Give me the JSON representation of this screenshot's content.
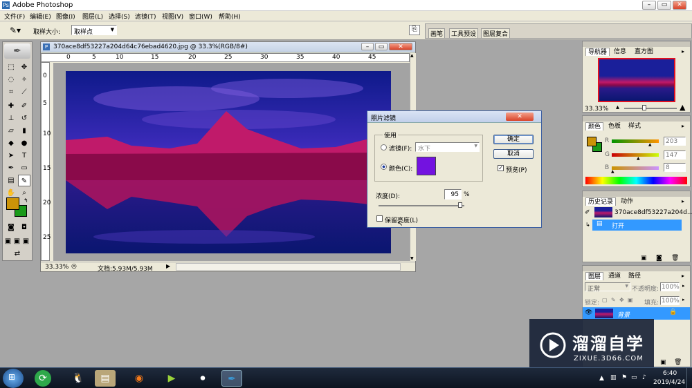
{
  "app": {
    "title": "Adobe Photoshop"
  },
  "menu": [
    "文件(F)",
    "编辑(E)",
    "图像(I)",
    "图层(L)",
    "选择(S)",
    "滤镜(T)",
    "视图(V)",
    "窗口(W)",
    "帮助(H)"
  ],
  "options": {
    "sample_label": "取样大小:",
    "sample_value": "取样点"
  },
  "dock_tabs": [
    "画笔",
    "工具预设",
    "图层复合"
  ],
  "doc": {
    "title": "370ace8df53227a204d64c76ebad4620.jpg @ 33.3%(RGB/8#)",
    "ruler_h": [
      "0",
      "5",
      "10",
      "15",
      "20",
      "25",
      "30",
      "35",
      "40",
      "45"
    ],
    "ruler_v": [
      "0",
      "5",
      "10",
      "15",
      "20",
      "25"
    ],
    "zoom": "33.33%",
    "doc_info": "文档:5.93M/5.93M"
  },
  "dialog": {
    "title": "照片滤镜",
    "group_label": "使用",
    "filter_label": "滤镜(F):",
    "filter_value": "水下",
    "color_label": "颜色(C):",
    "color_swatch": "#7312e0",
    "density_label": "浓度(D):",
    "density_value": "95",
    "density_unit": "%",
    "density_level": 0.95,
    "preserve_label": "保留亮度(L)",
    "ok": "确定",
    "cancel": "取消",
    "preview": "预览(P)"
  },
  "navigator": {
    "tabs": [
      "导航器",
      "信息",
      "直方图"
    ],
    "zoom": "33.33%"
  },
  "color_panel": {
    "tabs": [
      "颜色",
      "色板",
      "样式"
    ],
    "r_label": "R",
    "r_value": "203",
    "g_label": "G",
    "g_value": "147",
    "b_label": "B",
    "b_value": "8",
    "fg": "#cb9308",
    "bg": "#1a9a1a"
  },
  "history": {
    "tabs": [
      "历史记录",
      "动作"
    ],
    "snapshot": "370ace8df53227a204d...",
    "step": "打开"
  },
  "layers": {
    "tabs": [
      "图层",
      "通道",
      "路径"
    ],
    "mode": "正常",
    "opacity_label": "不透明度:",
    "opacity": "100%",
    "lock_label": "锁定:",
    "fill_label": "填充:",
    "fill": "100%",
    "layer_name": "背景"
  },
  "watermark": {
    "brand": "溜溜自学",
    "url": "ZIXUE.3D66.COM"
  },
  "taskbar": {
    "time": "6:40",
    "date": "2019/4/24"
  },
  "colors": {
    "accent": "#3399ff",
    "taskbar": "#0c1420"
  }
}
